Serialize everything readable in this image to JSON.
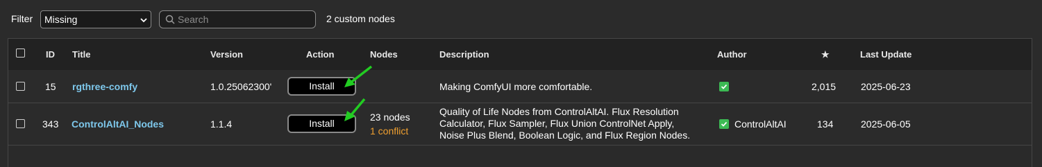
{
  "toolbar": {
    "filter_label": "Filter",
    "filter_value": "Missing",
    "search_placeholder": "Search",
    "count_text": "2 custom nodes"
  },
  "table": {
    "headers": {
      "id": "ID",
      "title": "Title",
      "version": "Version",
      "action": "Action",
      "nodes": "Nodes",
      "description": "Description",
      "author": "Author",
      "stars": "★",
      "last_update": "Last Update"
    },
    "rows": [
      {
        "id": "15",
        "title": "rgthree-comfy",
        "version": "1.0.25062300'",
        "action": "Install",
        "nodes": "",
        "conflict": "",
        "description": [
          "Making ComfyUI more comfortable."
        ],
        "author": "",
        "stars": "2,015",
        "last_update": "2025-06-23"
      },
      {
        "id": "343",
        "title": "ControlAltAI_Nodes",
        "version": "1.1.4",
        "action": "Install",
        "nodes": "23 nodes",
        "conflict": "1 conflict",
        "description": [
          "Quality of Life Nodes from ControlAltAI. Flux Resolution",
          "Calculator, Flux Sampler, Flux Union ControlNet Apply,",
          "Noise Plus Blend, Boolean Logic, and Flux Region Nodes."
        ],
        "author": "ControlAltAI",
        "stars": "134",
        "last_update": "2025-06-05"
      }
    ]
  },
  "colors": {
    "link": "#7ec8ec",
    "conflict": "#f0a030",
    "verified_badge": "#3cba54",
    "annotation_arrow": "#22cc22"
  }
}
